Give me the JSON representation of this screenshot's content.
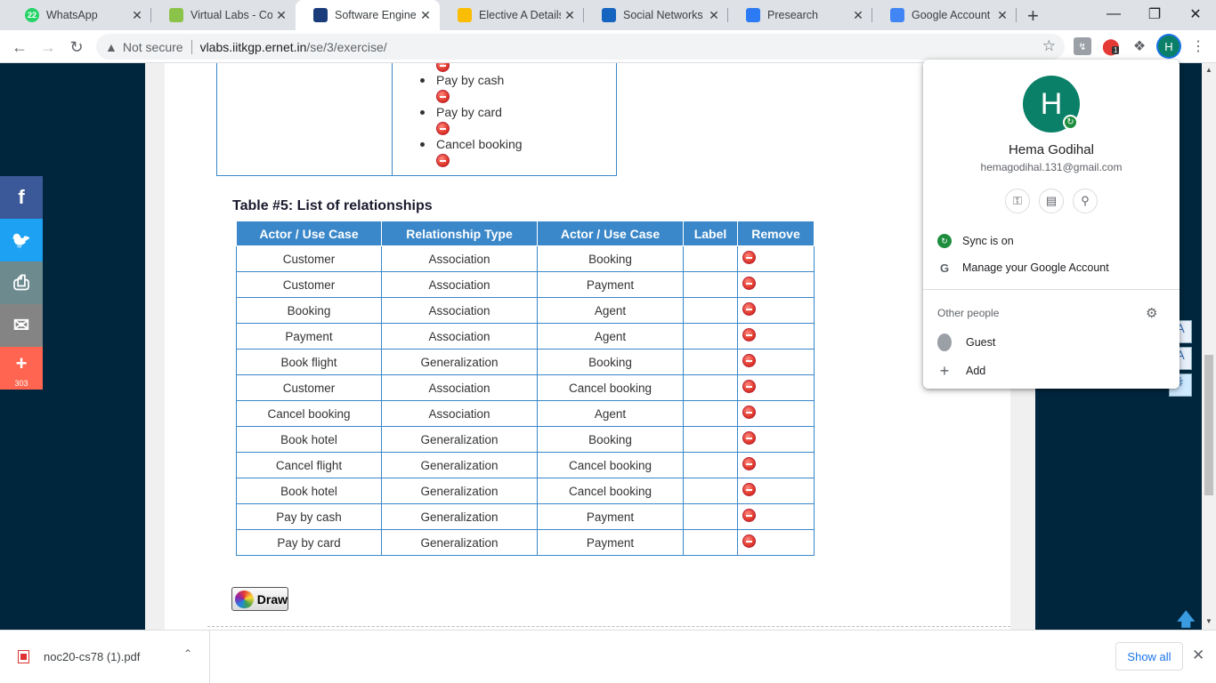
{
  "browser": {
    "tabs": [
      {
        "title": "WhatsApp",
        "badge": "22",
        "color": "#25d366"
      },
      {
        "title": "Virtual Labs - Com",
        "color": "#8bc34a"
      },
      {
        "title": "Software Engineer",
        "color": "#1a3c7a"
      },
      {
        "title": "Elective A Details",
        "color": "#fbbc04"
      },
      {
        "title": "Social Networks -",
        "color": "#1565c0"
      },
      {
        "title": "Presearch",
        "color": "#2d7bf4"
      },
      {
        "title": "Google Account",
        "color": "#4285f4"
      }
    ],
    "active_tab": 2,
    "address": {
      "security_label": "Not secure",
      "host": "vlabs.iitkgp.ernet.in",
      "path": "/se/3/exercise/"
    },
    "profile_initial": "H",
    "extension_badge": "1"
  },
  "page": {
    "use_cases": [
      "Pay by cash",
      "Pay by card",
      "Cancel booking"
    ],
    "table_title": "Table #5: List of relationships",
    "table_headers": [
      "Actor / Use Case",
      "Relationship Type",
      "Actor / Use Case",
      "Label",
      "Remove"
    ],
    "rows": [
      [
        "Customer",
        "Association",
        "Booking"
      ],
      [
        "Customer",
        "Association",
        "Payment"
      ],
      [
        "Booking",
        "Association",
        "Agent"
      ],
      [
        "Payment",
        "Association",
        "Agent"
      ],
      [
        "Book flight",
        "Generalization",
        "Booking"
      ],
      [
        "Customer",
        "Association",
        "Cancel booking"
      ],
      [
        "Cancel booking",
        "Association",
        "Agent"
      ],
      [
        "Book hotel",
        "Generalization",
        "Booking"
      ],
      [
        "Cancel flight",
        "Generalization",
        "Cancel booking"
      ],
      [
        "Book hotel",
        "Generalization",
        "Cancel booking"
      ],
      [
        "Pay by cash",
        "Generalization",
        "Payment"
      ],
      [
        "Pay by card",
        "Generalization",
        "Payment"
      ]
    ],
    "draw_label": "Draw"
  },
  "share": {
    "buttons": [
      {
        "icon": "f",
        "name": "facebook",
        "color": "#3b5998"
      },
      {
        "icon": "twitter-bird",
        "name": "twitter",
        "color": "#1da1f2"
      },
      {
        "icon": "print",
        "name": "print",
        "color": "#6d8a8f"
      },
      {
        "icon": "mail",
        "name": "email",
        "color": "#848484"
      },
      {
        "icon": "+",
        "name": "more",
        "color": "#ff6550"
      }
    ],
    "count": "303"
  },
  "profile_menu": {
    "initial": "H",
    "name": "Hema Godihal",
    "email": "hemagodihal.131@gmail.com",
    "sync_label": "Sync is on",
    "manage_label": "Manage your Google Account",
    "other_people_label": "Other people",
    "guest_label": "Guest",
    "add_label": "Add"
  },
  "downloads": {
    "file_name": "noc20-cs78 (1).pdf",
    "show_all_label": "Show all"
  }
}
